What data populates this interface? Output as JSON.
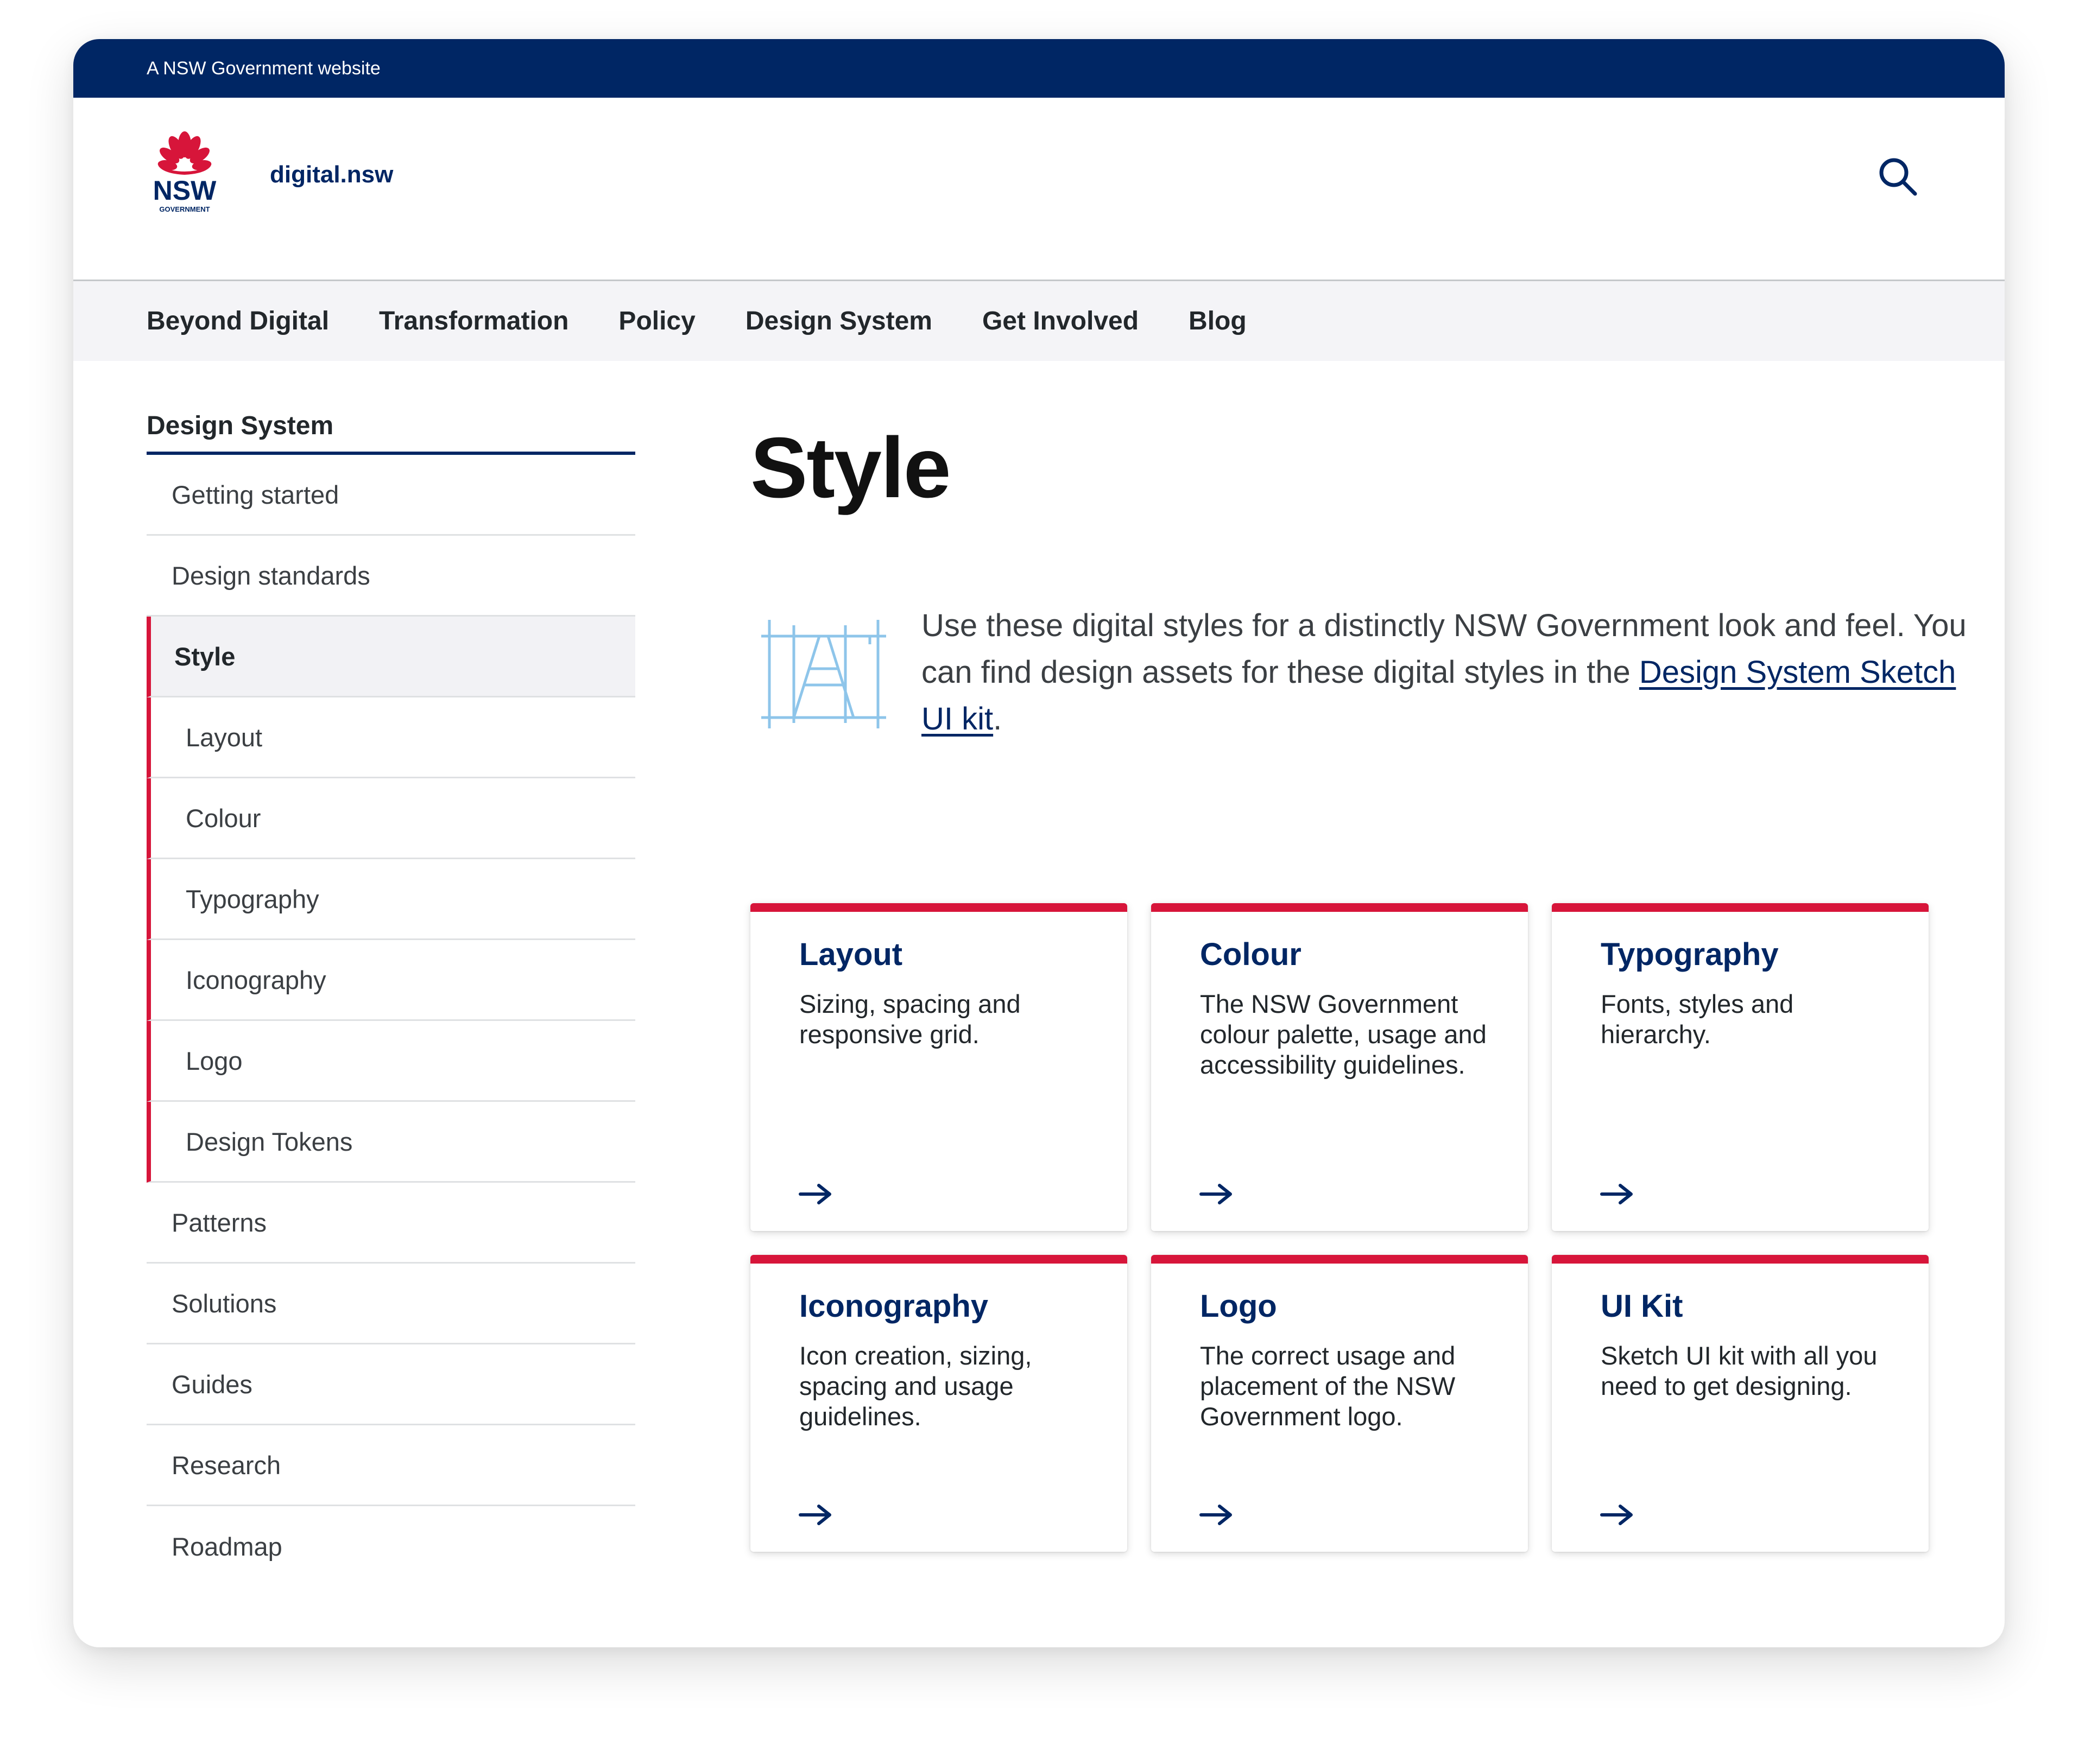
{
  "masthead": {
    "text": "A NSW Government website"
  },
  "header": {
    "site_name": "digital.nsw",
    "logo": {
      "lettering": "NSW",
      "sub_lettering": "GOVERNMENT",
      "icon": "waratah-logo-icon"
    },
    "search_icon": "search-icon"
  },
  "main_nav": {
    "items": [
      {
        "label": "Beyond Digital"
      },
      {
        "label": "Transformation"
      },
      {
        "label": "Policy"
      },
      {
        "label": "Design System"
      },
      {
        "label": "Get Involved"
      },
      {
        "label": "Blog"
      }
    ]
  },
  "side_nav": {
    "title": "Design System",
    "items": [
      {
        "label": "Getting started"
      },
      {
        "label": "Design standards"
      },
      {
        "label": "Style"
      },
      {
        "label": "Layout"
      },
      {
        "label": "Colour"
      },
      {
        "label": "Typography"
      },
      {
        "label": "Iconography"
      },
      {
        "label": "Logo"
      },
      {
        "label": "Design Tokens"
      },
      {
        "label": "Patterns"
      },
      {
        "label": "Solutions"
      },
      {
        "label": "Guides"
      },
      {
        "label": "Research"
      },
      {
        "label": "Roadmap"
      }
    ]
  },
  "page": {
    "title": "Style",
    "intro": {
      "icon": "typography-grid-icon",
      "text_before": "Use these digital styles for a distinctly NSW Government look and feel. You can find design assets for these digital styles in the ",
      "link_text": "Design System Sketch UI kit",
      "text_after": "."
    }
  },
  "cards": [
    {
      "title": "Layout",
      "description": "Sizing, spacing and responsive grid.",
      "icon": "arrow-right-icon"
    },
    {
      "title": "Colour",
      "description": "The NSW Government colour palette, usage and accessibility guidelines.",
      "icon": "arrow-right-icon"
    },
    {
      "title": "Typography",
      "description": "Fonts, styles and hierarchy.",
      "icon": "arrow-right-icon"
    },
    {
      "title": "Iconography",
      "description": "Icon creation, sizing, spacing and usage guidelines.",
      "icon": "arrow-right-icon"
    },
    {
      "title": "Logo",
      "description": "The correct usage and placement of the NSW Government logo.",
      "icon": "arrow-right-icon"
    },
    {
      "title": "UI Kit",
      "description": "Sketch UI kit with all you need to get designing.",
      "icon": "arrow-right-icon"
    }
  ],
  "colors": {
    "navy": "#002664",
    "red": "#d7153a",
    "nav_bg": "#f4f4f7",
    "icon_blue": "#8ec5ea"
  }
}
